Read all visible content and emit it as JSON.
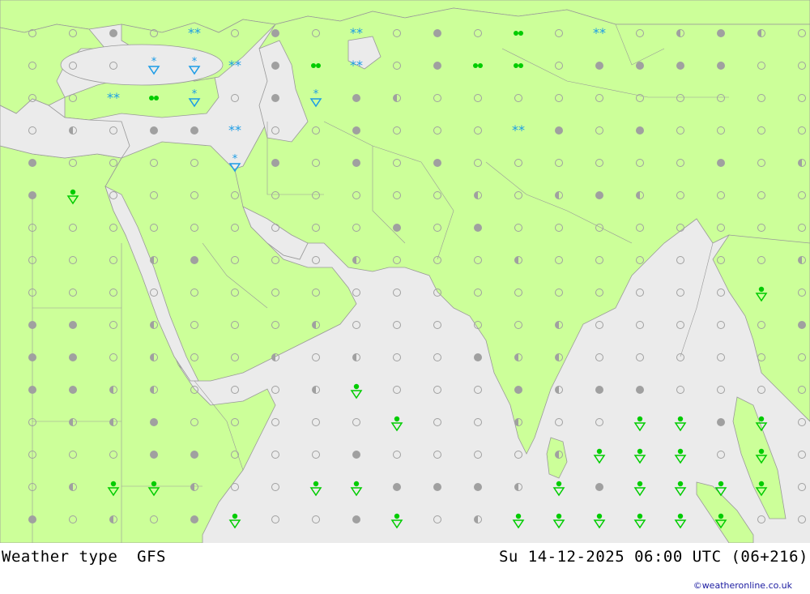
{
  "footer": {
    "left_label": "Weather type",
    "model": "GFS",
    "datetime": "Su 14-12-2025 06:00 UTC (06+216)",
    "credit": "©weatheronline.co.uk"
  },
  "colors": {
    "land": "#ccff99",
    "sea": "#ebebeb",
    "border": "#999999",
    "snow": "#1c9ce6",
    "rain": "#00cc00",
    "cloud_gray": "#a0a0a0"
  },
  "legend_symbols": [
    "clear-circle",
    "half-cloud-circle",
    "overcast-dot",
    "snow-icon",
    "rain-icon",
    "shower-icon"
  ],
  "grid": {
    "columns": 19,
    "rows": 16,
    "cells": [
      "c,c,o,c,s,c,o,c,s,c,o,c,r,c,s,c,h,o,h,c",
      "c,c,c,sh,sh,s,o,r,s,c,o,r,r,c,o,o,o,o,c,c",
      "c,c,s,r,sh,c,o,sh,o,h,c,c,c,c,c,c,c,c,c,c",
      "c,h,c,o,o,s,c,c,o,c,c,c,s,o,c,o,c,c,c,c",
      "o,c,c,c,c,sh,o,c,o,c,o,c,c,c,c,c,c,o,c,h",
      "o,rr,c,c,c,c,c,c,c,c,c,h,c,h,o,h,c,c,c,c",
      "c,c,c,c,c,c,c,c,c,o,c,o,c,c,c,c,c,c,c,c",
      "c,c,c,h,o,c,c,c,h,c,c,c,h,c,c,c,c,c,c,h",
      "c,c,c,c,c,c,c,c,c,c,c,c,c,c,c,c,c,c,rr,c",
      "o,o,c,h,c,c,c,h,c,c,c,c,c,h,c,c,c,c,c,o",
      "o,o,c,h,c,c,h,c,h,c,c,o,h,h,c,c,c,c,c,c",
      "o,o,h,h,c,c,c,h,rr,c,c,c,o,h,o,o,c,c,c,c",
      "c,h,h,o,c,c,c,c,c,rr,c,c,h,c,c,rr,rr,o,rr,c",
      "c,c,c,o,o,c,c,c,o,c,c,c,c,h,rr,rr,rr,c,rr,c",
      "c,h,rr,rr,h,c,c,rr,rr,o,o,o,h,rr,o,rr,rr,rr,rr,c",
      "o,c,h,c,o,rr,c,c,o,rr,c,h,rr,rr,rr,rr,rr,rr,c,c"
    ]
  }
}
